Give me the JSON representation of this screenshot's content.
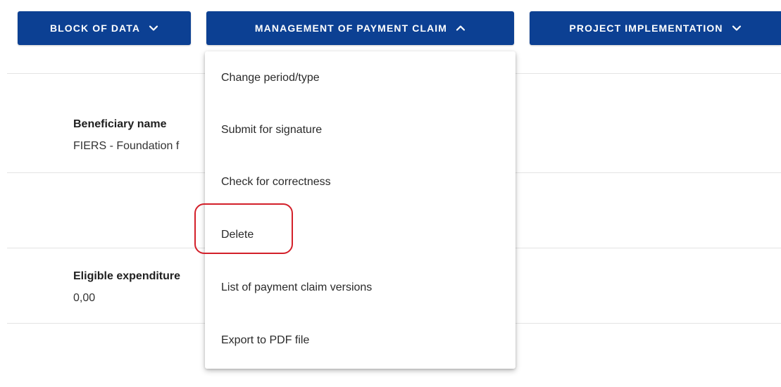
{
  "nav": {
    "block_of_data": {
      "label": "BLOCK OF DATA",
      "chevron": "chevron-down-icon"
    },
    "management": {
      "label": "MANAGEMENT OF PAYMENT CLAIM",
      "chevron": "chevron-up-icon"
    },
    "project_impl": {
      "label": "PROJECT IMPLEMENTATION",
      "chevron": "chevron-down-icon"
    }
  },
  "fields": {
    "beneficiary": {
      "label": "Beneficiary name",
      "value": "FIERS - Foundation f"
    },
    "eligible": {
      "label": "Eligible expenditure",
      "value": "0,00"
    }
  },
  "menu": {
    "items": [
      {
        "label": "Change period/type"
      },
      {
        "label": "Submit for signature"
      },
      {
        "label": "Check for correctness"
      },
      {
        "label": "Delete"
      },
      {
        "label": "List of payment claim versions"
      },
      {
        "label": "Export to PDF file"
      }
    ]
  },
  "colors": {
    "primary": "#0c4093",
    "highlight": "#d3202a"
  }
}
